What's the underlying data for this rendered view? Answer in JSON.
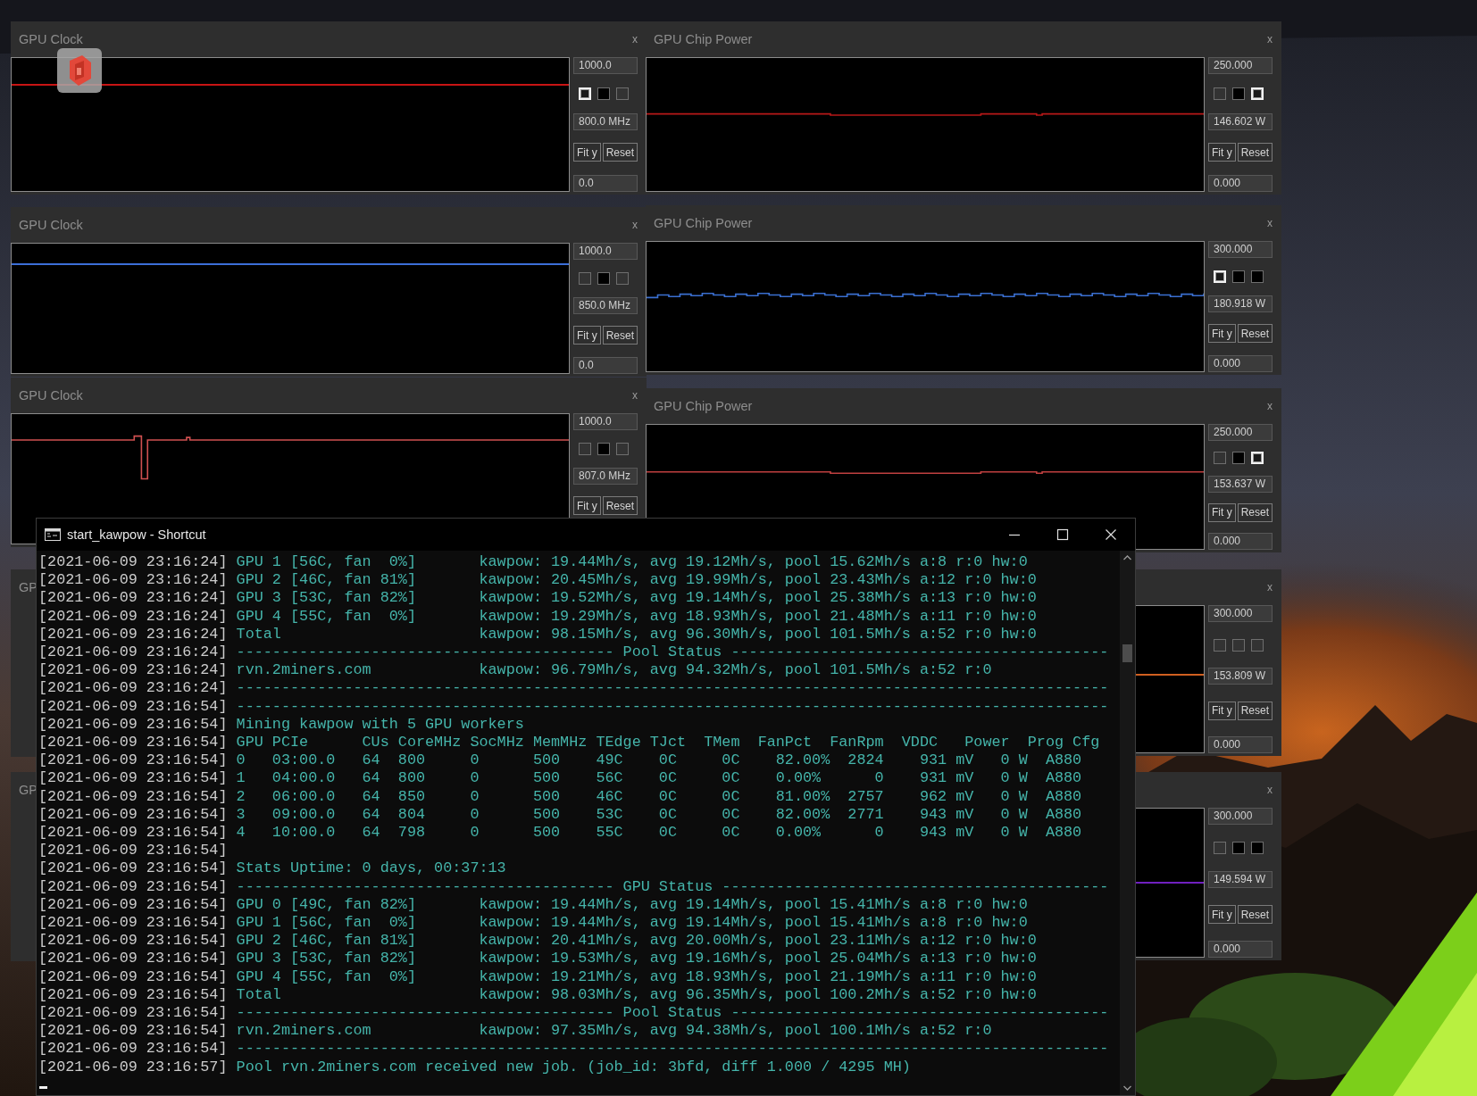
{
  "monitor_windows": [
    {
      "title": "GPU Clock",
      "close": "x",
      "max": "1000.0",
      "checkboxes": [
        {
          "checked": true,
          "filled": false
        },
        {
          "checked": false,
          "filled": true
        },
        {
          "checked": false,
          "filled": false
        }
      ],
      "reading": "800.0 MHz",
      "buttons": [
        "Fit y",
        "Reset"
      ],
      "min": "0.0",
      "trace": {
        "kind": "flat",
        "color": "#c81414"
      }
    },
    {
      "title": "GPU Chip Power",
      "close": "x",
      "max": "250.000",
      "checkboxes": [
        {
          "checked": false,
          "filled": false
        },
        {
          "checked": false,
          "filled": true
        },
        {
          "checked": true,
          "filled": false
        }
      ],
      "reading": "146.602 W",
      "buttons": [
        "Fit y",
        "Reset"
      ],
      "min": "0.000",
      "trace": {
        "kind": "notched",
        "color": "#b81818"
      }
    },
    {
      "title": "GPU Clock",
      "close": "x",
      "max": "1000.0",
      "checkboxes": [
        {
          "checked": false,
          "filled": false
        },
        {
          "checked": false,
          "filled": true
        },
        {
          "checked": false,
          "filled": false
        }
      ],
      "reading": "850.0 MHz",
      "buttons": [
        "Fit y",
        "Reset"
      ],
      "min": "0.0",
      "trace": {
        "kind": "flat",
        "color": "#3c6fd8"
      }
    },
    {
      "title": "GPU Chip Power",
      "close": "x",
      "max": "300.000",
      "checkboxes": [
        {
          "checked": true,
          "filled": false
        },
        {
          "checked": false,
          "filled": true
        },
        {
          "checked": false,
          "filled": true
        }
      ],
      "reading": "180.918 W",
      "buttons": [
        "Fit y",
        "Reset"
      ],
      "min": "0.000",
      "trace": {
        "kind": "noisy",
        "color": "#3a6fd0"
      }
    },
    {
      "title": "GPU Clock",
      "close": "x",
      "max": "1000.0",
      "checkboxes": [
        {
          "checked": false,
          "filled": false
        },
        {
          "checked": false,
          "filled": true
        },
        {
          "checked": false,
          "filled": false
        }
      ],
      "reading": "807.0 MHz",
      "buttons": [
        "Fit y",
        "Reset"
      ],
      "trace": {
        "kind": "dip",
        "color": "#d05050"
      }
    },
    {
      "title": "GPU Chip Power",
      "close": "x",
      "max": "250.000",
      "checkboxes": [
        {
          "checked": false,
          "filled": false
        },
        {
          "checked": false,
          "filled": true
        },
        {
          "checked": true,
          "filled": false
        }
      ],
      "reading": "153.637 W",
      "buttons": [
        "Fit y",
        "Reset"
      ],
      "min": "0.000",
      "trace": {
        "kind": "notched",
        "color": "#c04040"
      }
    },
    {
      "title": "GP"
    },
    {
      "close": "x",
      "max": "300.000",
      "checkboxes": [
        {
          "checked": false,
          "filled": false
        },
        {
          "checked": false,
          "filled": false
        },
        {
          "checked": false,
          "filled": false
        }
      ],
      "reading": "153.809 W",
      "buttons": [
        "Fit y",
        "Reset"
      ],
      "min": "0.000",
      "trace": {
        "kind": "flat",
        "color": "#d06020"
      }
    },
    {
      "title": "GP"
    },
    {
      "close": "x",
      "max": "300.000",
      "checkboxes": [
        {
          "checked": false,
          "filled": false
        },
        {
          "checked": false,
          "filled": true
        },
        {
          "checked": false,
          "filled": true
        }
      ],
      "reading": "149.594 W",
      "buttons": [
        "Fit y",
        "Reset"
      ],
      "min": "0.000",
      "trace": {
        "kind": "flat",
        "color": "#7020c0"
      }
    }
  ],
  "console": {
    "title": "start_kawpow - Shortcut",
    "lines": [
      {
        "time": "[2021-06-09 23:16:24]",
        "text": "GPU 1 [56C, fan  0%]       kawpow: 19.44Mh/s, avg 19.12Mh/s, pool 15.62Mh/s a:8 r:0 hw:0"
      },
      {
        "time": "[2021-06-09 23:16:24]",
        "text": "GPU 2 [46C, fan 81%]       kawpow: 20.45Mh/s, avg 19.99Mh/s, pool 23.43Mh/s a:12 r:0 hw:0"
      },
      {
        "time": "[2021-06-09 23:16:24]",
        "text": "GPU 3 [53C, fan 82%]       kawpow: 19.52Mh/s, avg 19.14Mh/s, pool 25.38Mh/s a:13 r:0 hw:0"
      },
      {
        "time": "[2021-06-09 23:16:24]",
        "text": "GPU 4 [55C, fan  0%]       kawpow: 19.29Mh/s, avg 18.93Mh/s, pool 21.48Mh/s a:11 r:0 hw:0"
      },
      {
        "time": "[2021-06-09 23:16:24]",
        "text": "Total                      kawpow: 98.15Mh/s, avg 96.30Mh/s, pool 101.5Mh/s a:52 r:0 hw:0"
      },
      {
        "time": "[2021-06-09 23:16:24]",
        "text": "------------------------------------------ Pool Status ------------------------------------------"
      },
      {
        "time": "[2021-06-09 23:16:24]",
        "text": "rvn.2miners.com            kawpow: 96.79Mh/s, avg 94.32Mh/s, pool 101.5Mh/s a:52 r:0"
      },
      {
        "time": "[2021-06-09 23:16:24]",
        "text": "-------------------------------------------------------------------------------------------------"
      },
      {
        "time": "[2021-06-09 23:16:54]",
        "text": "-------------------------------------------------------------------------------------------------"
      },
      {
        "time": "[2021-06-09 23:16:54]",
        "text": "Mining kawpow with 5 GPU workers"
      },
      {
        "time": "[2021-06-09 23:16:54]",
        "text": "GPU PCIe      CUs CoreMHz SocMHz MemMHz TEdge TJct  TMem  FanPct  FanRpm  VDDC   Power  Prog Cfg"
      },
      {
        "time": "[2021-06-09 23:16:54]",
        "text": "0   03:00.0   64  800     0      500    49C    0C     0C    82.00%  2824    931 mV   0 W  A880"
      },
      {
        "time": "[2021-06-09 23:16:54]",
        "text": "1   04:00.0   64  800     0      500    56C    0C     0C    0.00%      0    931 mV   0 W  A880"
      },
      {
        "time": "[2021-06-09 23:16:54]",
        "text": "2   06:00.0   64  850     0      500    46C    0C     0C    81.00%  2757    962 mV   0 W  A880"
      },
      {
        "time": "[2021-06-09 23:16:54]",
        "text": "3   09:00.0   64  804     0      500    53C    0C     0C    82.00%  2771    943 mV   0 W  A880"
      },
      {
        "time": "[2021-06-09 23:16:54]",
        "text": "4   10:00.0   64  798     0      500    55C    0C     0C    0.00%      0    943 mV   0 W  A880"
      },
      {
        "time": "[2021-06-09 23:16:54]"
      },
      {
        "time": "[2021-06-09 23:16:54]",
        "text": "Stats Uptime: 0 days, 00:37:13"
      },
      {
        "time": "[2021-06-09 23:16:54]",
        "text": "------------------------------------------ GPU Status -------------------------------------------"
      },
      {
        "time": "[2021-06-09 23:16:54]",
        "text": "GPU 0 [49C, fan 82%]       kawpow: 19.44Mh/s, avg 19.14Mh/s, pool 15.41Mh/s a:8 r:0 hw:0"
      },
      {
        "time": "[2021-06-09 23:16:54]",
        "text": "GPU 1 [56C, fan  0%]       kawpow: 19.44Mh/s, avg 19.14Mh/s, pool 15.41Mh/s a:8 r:0 hw:0"
      },
      {
        "time": "[2021-06-09 23:16:54]",
        "text": "GPU 2 [46C, fan 81%]       kawpow: 20.41Mh/s, avg 20.00Mh/s, pool 23.11Mh/s a:12 r:0 hw:0"
      },
      {
        "time": "[2021-06-09 23:16:54]",
        "text": "GPU 3 [53C, fan 82%]       kawpow: 19.53Mh/s, avg 19.16Mh/s, pool 25.04Mh/s a:13 r:0 hw:0"
      },
      {
        "time": "[2021-06-09 23:16:54]",
        "text": "GPU 4 [55C, fan  0%]       kawpow: 19.21Mh/s, avg 18.93Mh/s, pool 21.19Mh/s a:11 r:0 hw:0"
      },
      {
        "time": "[2021-06-09 23:16:54]",
        "text": "Total                      kawpow: 98.03Mh/s, avg 96.35Mh/s, pool 100.2Mh/s a:52 r:0 hw:0"
      },
      {
        "time": "[2021-06-09 23:16:54]",
        "text": "------------------------------------------ Pool Status ------------------------------------------"
      },
      {
        "time": "[2021-06-09 23:16:54]",
        "text": "rvn.2miners.com            kawpow: 97.35Mh/s, avg 94.38Mh/s, pool 100.1Mh/s a:52 r:0"
      },
      {
        "time": "[2021-06-09 23:16:54]",
        "text": "-------------------------------------------------------------------------------------------------"
      },
      {
        "time": "[2021-06-09 23:16:57]",
        "text": "Pool rvn.2miners.com received new job. (job_id: 3bfd, diff 1.000 / 4295 MH)"
      }
    ]
  }
}
